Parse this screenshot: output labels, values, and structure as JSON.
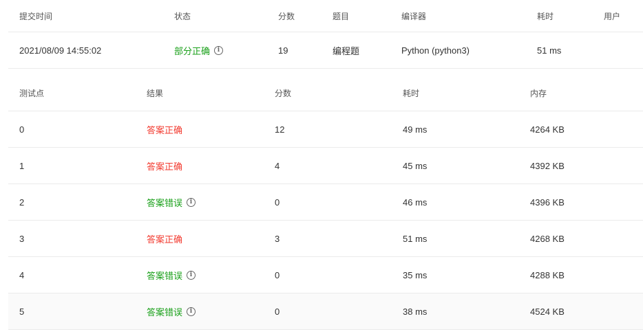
{
  "submission": {
    "headers": [
      "提交时间",
      "状态",
      "分数",
      "题目",
      "编译器",
      "耗时",
      "用户"
    ],
    "row": {
      "time": "2021/08/09 14:55:02",
      "status": "部分正确",
      "score": "19",
      "problem": "编程题",
      "compiler": "Python (python3)",
      "duration": "51 ms",
      "user": ""
    }
  },
  "cases": {
    "headers": [
      "测试点",
      "结果",
      "分数",
      "耗时",
      "内存"
    ],
    "rows": [
      {
        "id": "0",
        "result": "答案正确",
        "result_type": "correct",
        "score": "12",
        "time": "49 ms",
        "memory": "4264 KB"
      },
      {
        "id": "1",
        "result": "答案正确",
        "result_type": "correct",
        "score": "4",
        "time": "45 ms",
        "memory": "4392 KB"
      },
      {
        "id": "2",
        "result": "答案错误",
        "result_type": "wrong",
        "score": "0",
        "time": "46 ms",
        "memory": "4396 KB"
      },
      {
        "id": "3",
        "result": "答案正确",
        "result_type": "correct",
        "score": "3",
        "time": "51 ms",
        "memory": "4268 KB"
      },
      {
        "id": "4",
        "result": "答案错误",
        "result_type": "wrong",
        "score": "0",
        "time": "35 ms",
        "memory": "4288 KB"
      },
      {
        "id": "5",
        "result": "答案错误",
        "result_type": "wrong",
        "score": "0",
        "time": "38 ms",
        "memory": "4524 KB"
      }
    ]
  },
  "info_icon": "i",
  "colors": {
    "correct": "#f23a2f",
    "wrong": "#1aa01a",
    "partial": "#1aa01a"
  }
}
